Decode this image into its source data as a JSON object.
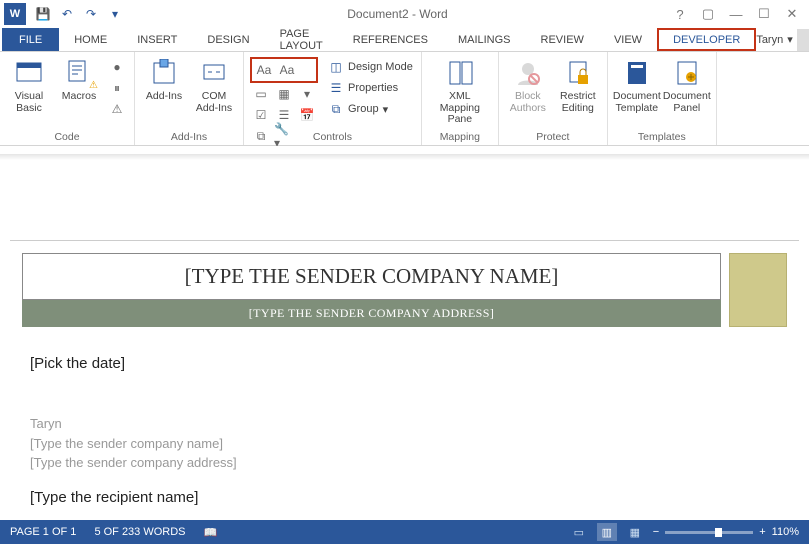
{
  "title": "Document2 - Word",
  "qat": {
    "save": "save",
    "undo": "undo",
    "redo": "redo",
    "customize": "customize"
  },
  "tabs": [
    "FILE",
    "HOME",
    "INSERT",
    "DESIGN",
    "PAGE LAYOUT",
    "REFERENCES",
    "MAILINGS",
    "REVIEW",
    "VIEW",
    "DEVELOPER"
  ],
  "user": {
    "name": "Taryn"
  },
  "ribbon": {
    "code": {
      "label": "Code",
      "visual_basic": "Visual\nBasic",
      "macros": "Macros"
    },
    "addins": {
      "label": "Add-Ins",
      "addins": "Add-Ins",
      "com": "COM\nAdd-Ins"
    },
    "controls": {
      "label": "Controls",
      "design_mode": "Design Mode",
      "properties": "Properties",
      "group": "Group"
    },
    "mapping": {
      "label": "Mapping",
      "xml_pane": "XML Mapping\nPane"
    },
    "protect": {
      "label": "Protect",
      "block": "Block\nAuthors",
      "restrict": "Restrict\nEditing"
    },
    "templates": {
      "label": "Templates",
      "doc_tmpl": "Document\nTemplate",
      "doc_panel": "Document\nPanel"
    }
  },
  "doc": {
    "company_name": "[TYPE THE SENDER COMPANY NAME]",
    "company_addr": "[TYPE THE SENDER COMPANY ADDRESS]",
    "pick_date": "[Pick the date]",
    "author": "Taryn",
    "sender_name_ph": "[Type the sender company name]",
    "sender_addr_ph": "[Type the sender company address]",
    "recipient": "[Type the recipient name]"
  },
  "status": {
    "page": "PAGE 1 OF 1",
    "words": "5 OF 233 WORDS",
    "zoom": "110%"
  }
}
